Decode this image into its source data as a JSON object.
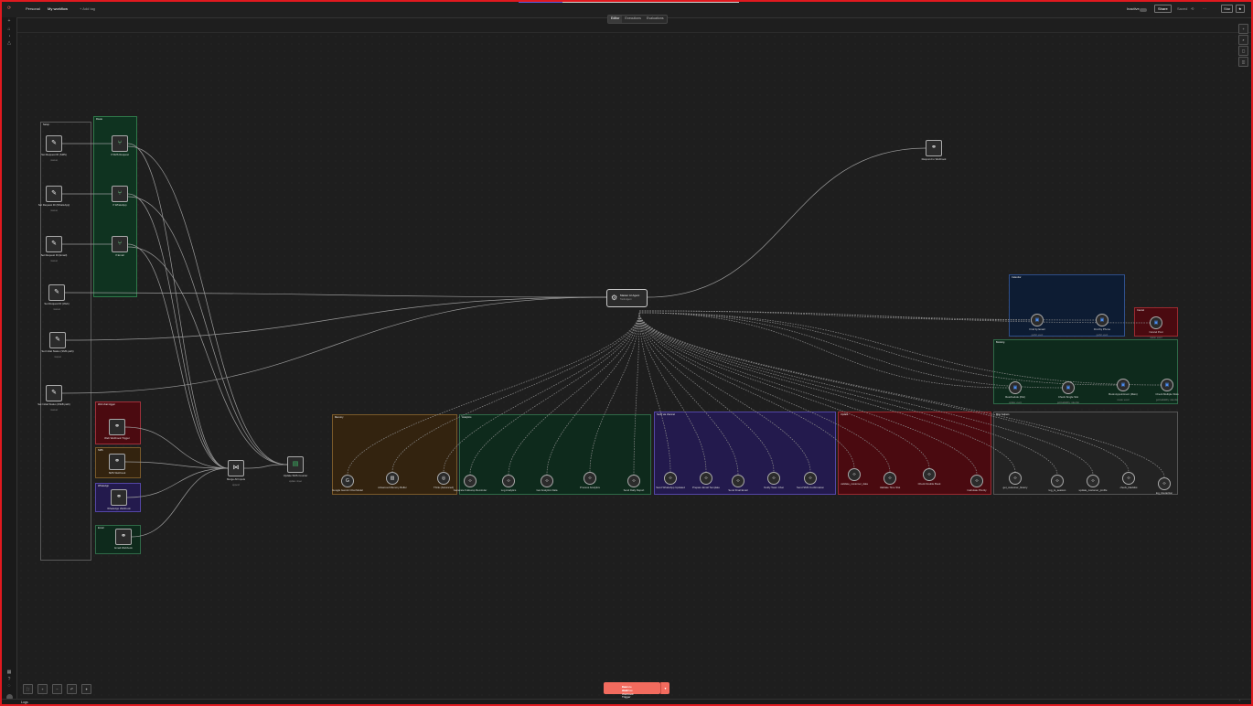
{
  "header": {
    "workspace": "Personal",
    "workflow_name": "My workflow",
    "tag_hint": "+ Add tag",
    "inactive_label": "Inactive",
    "share_label": "Share",
    "saved_label": "Saved",
    "star_label": "Star",
    "tabs": [
      "Editor",
      "Executions",
      "Evaluations"
    ]
  },
  "agent": {
    "title": "Master AI Agent",
    "subtitle": "Tools Agent",
    "icon": "robot-icon"
  },
  "respond": {
    "label": "Respond to Webhook",
    "icon": "webhook-icon"
  },
  "left_column": {
    "group_label": "Setup",
    "nodes": [
      {
        "label": "Set Request ID (SMS)",
        "sub": "manual"
      },
      {
        "label": "Set Request ID (WhatsApp)",
        "sub": "manual"
      },
      {
        "label": "Set Request ID (Email)",
        "sub": "manual"
      },
      {
        "label": "Set Request ID (Web)",
        "sub": "manual"
      },
      {
        "label": "Set Initial Status (SMS path)",
        "sub": "manual"
      },
      {
        "label": "Set Initial Status (WEB path)",
        "sub": "manual"
      }
    ]
  },
  "routing": {
    "zone_label": "Route",
    "nodes": [
      {
        "label": "If SMS Request"
      },
      {
        "label": "If WhatsApp"
      },
      {
        "label": "If Email"
      }
    ]
  },
  "triggers": [
    {
      "zone": "Web chat trigger",
      "label": "Web Webhook Trigger"
    },
    {
      "zone": "SMS",
      "label": "SMS Webhook"
    },
    {
      "zone": "WhatsApp",
      "label": "WhatsApp Webhook"
    },
    {
      "zone": "Email",
      "label": "Email Webhook"
    }
  ],
  "merge": {
    "label": "Merge All Inputs",
    "sub": "append"
  },
  "update_sms": {
    "label": "Update SMS Counter",
    "sub": "update: sheet"
  },
  "zones": [
    {
      "title": "Memory",
      "color": "#33230f",
      "border": "#7a5a2a",
      "nodes": [
        {
          "label": "Google Gemini Chat Model"
        },
        {
          "label": "Advanced Memory Buffer"
        },
        {
          "label": "Think (Advanced)"
        }
      ]
    },
    {
      "title": "Analytics",
      "color": "#0e2a1c",
      "border": "#2f6a48",
      "nodes": [
        {
          "label": "Generate Followup Reminder"
        },
        {
          "label": "Log Analytics"
        },
        {
          "label": "Get Analytics Data"
        },
        {
          "label": "Process Analytics"
        },
        {
          "label": "Send Daily Report"
        }
      ]
    },
    {
      "title": "Send via channel",
      "color": "#231a4d",
      "border": "#5446a6",
      "nodes": [
        {
          "label": "Send WhatsApp Updated"
        },
        {
          "label": "Prepare Email Template"
        },
        {
          "label": "Send Final Email"
        },
        {
          "label": "Notify Team Chat"
        },
        {
          "label": "Send SMS Confirmation"
        }
      ]
    },
    {
      "title": "Update",
      "color": "#4a0a10",
      "border": "#9a2a30",
      "nodes": [
        {
          "label": "validate_customer_data"
        },
        {
          "label": "Validate Time Slot"
        },
        {
          "label": "Check Double Book"
        },
        {
          "label": "Calculate Priority"
        }
      ]
    },
    {
      "title": "Misc helpers",
      "color": "#232323",
      "border": "#555",
      "nodes": [
        {
          "label": "get_customer_history"
        },
        {
          "label": "log_to_session"
        },
        {
          "label": "update_customer_profile"
        },
        {
          "label": "check_blacklist"
        },
        {
          "label": "log_interaction"
        }
      ]
    }
  ],
  "calendar_zone": {
    "title": "Calendar",
    "color": "#0d1c33",
    "border": "#2f4f8a",
    "nodes": [
      {
        "label": "Find by Email",
        "sub": "getAll: event"
      },
      {
        "label": "Find by Phone",
        "sub": "getAll: event"
      }
    ]
  },
  "cancel_zone": {
    "title": "Cancel",
    "color": "#4a0a10",
    "border": "#9a2a30",
    "nodes": [
      {
        "label": "Cancel Post",
        "sub": "delete: event"
      }
    ]
  },
  "sheets_zone": {
    "title": "Booking",
    "color": "#0e2a1c",
    "border": "#2f6a48",
    "nodes": [
      {
        "label": "Reschedule (Pat)",
        "sub": "update: event"
      },
      {
        "label": "Check Single Slot",
        "sub": "getAvailability: calendar"
      },
      {
        "label": "Book Appointment (Main)",
        "sub": "create: event"
      },
      {
        "label": "Check Multiple Slots",
        "sub": "getAvailability: calendar"
      }
    ]
  },
  "run_button": {
    "line1": "Execute workflow",
    "line2": "from Web Webhook Trigger"
  },
  "footer": {
    "logs": "Logs"
  },
  "colors": {
    "accent": "#f26b5e",
    "frame": "#e0191f"
  }
}
